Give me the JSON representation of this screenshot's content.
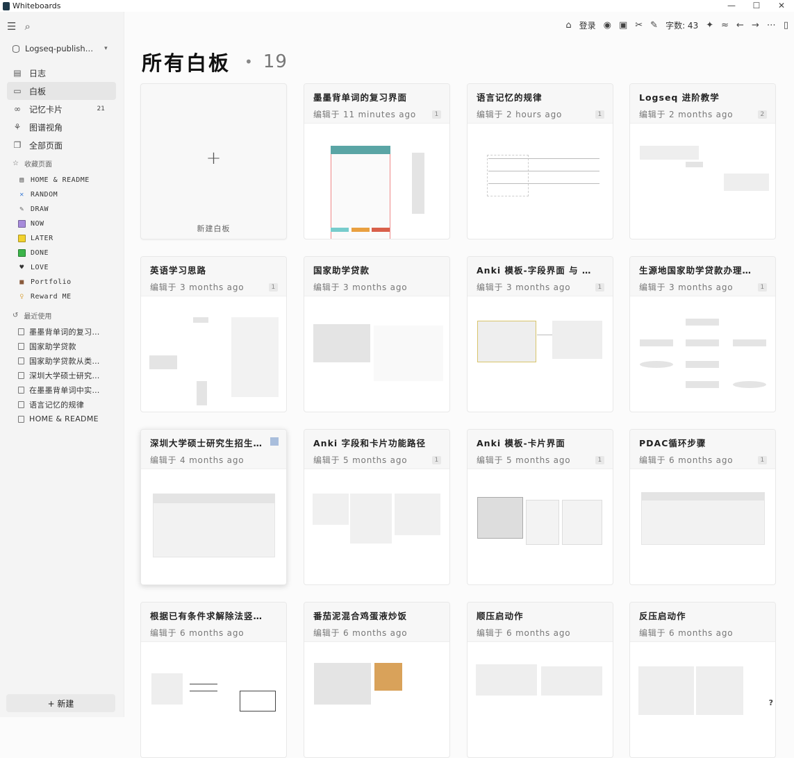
{
  "window": {
    "title": "Whiteboards",
    "min": "—",
    "max": "☐",
    "close": "✕"
  },
  "sidebar": {
    "graph": "Logseq-publish…",
    "nav": [
      {
        "icon": "▤",
        "label": "日志",
        "count": ""
      },
      {
        "icon": "▭",
        "label": "白板",
        "count": ""
      },
      {
        "icon": "∞",
        "label": "记忆卡片",
        "count": "21"
      },
      {
        "icon": "⚘",
        "label": "图谱视角",
        "count": ""
      },
      {
        "icon": "❐",
        "label": "全部页面",
        "count": ""
      }
    ],
    "favorites_header": "收藏页面",
    "favorites": [
      {
        "label": "HOME & README",
        "icon": "▤",
        "color": "#555"
      },
      {
        "label": "RANDOM",
        "icon": "✕",
        "color": "#3a7bd5"
      },
      {
        "label": "DRAW",
        "icon": "✎",
        "color": "#666"
      },
      {
        "label": "NOW",
        "icon": "",
        "color": "#a78bdb"
      },
      {
        "label": "LATER",
        "icon": "",
        "color": "#f2d22e"
      },
      {
        "label": "DONE",
        "icon": "",
        "color": "#3cb54a"
      },
      {
        "label": "LOVE",
        "icon": "♥",
        "color": "#333"
      },
      {
        "label": "Portfolio",
        "icon": "■",
        "color": "#8a5a3c"
      },
      {
        "label": "Reward ME",
        "icon": "♀",
        "color": "#d9a441"
      }
    ],
    "recent_header": "最近使用",
    "recent": [
      "墨墨背单词的复习…",
      "国家助学贷款",
      "国家助学贷款从类…",
      "深圳大学硕士研究…",
      "在墨墨背单词中实…",
      "语言记忆的规律",
      "HOME & README"
    ],
    "new_button": "+ 新建"
  },
  "toolbar": {
    "login": "登录",
    "word_count": "字数: 43"
  },
  "page": {
    "title": "所有白板",
    "count": "19"
  },
  "new_card_label": "新建白板",
  "cards": [
    {
      "title": "墨墨背单词的复习界面",
      "meta": "编辑于 11 minutes ago",
      "badge": "1"
    },
    {
      "title": "语言记忆的规律",
      "meta": "编辑于 2 hours ago",
      "badge": "1"
    },
    {
      "title": "Logseq 进阶教学",
      "meta": "编辑于 2 months ago",
      "badge": "2"
    },
    {
      "title": "英语学习思路",
      "meta": "编辑于 3 months ago",
      "badge": "1"
    },
    {
      "title": "国家助学贷款",
      "meta": "编辑于 3 months ago",
      "badge": ""
    },
    {
      "title": "Anki 模板-字段界面 与 …",
      "meta": "编辑于 3 months ago",
      "badge": "1"
    },
    {
      "title": "生源地国家助学贷款办理…",
      "meta": "编辑于 3 months ago",
      "badge": "1"
    },
    {
      "title": "深圳大学硕士研究生招生…",
      "meta": "编辑于 4 months ago",
      "badge": ""
    },
    {
      "title": "Anki 字段和卡片功能路径",
      "meta": "编辑于 5 months ago",
      "badge": "1"
    },
    {
      "title": "Anki 模板-卡片界面",
      "meta": "编辑于 5 months ago",
      "badge": "1"
    },
    {
      "title": "PDAC循环步骤",
      "meta": "编辑于 6 months ago",
      "badge": "1"
    },
    {
      "title": "根据已有条件求解除法竖…",
      "meta": "编辑于 6 months ago",
      "badge": ""
    },
    {
      "title": "番茄泥混合鸡蛋液炒饭",
      "meta": "编辑于 6 months ago",
      "badge": ""
    },
    {
      "title": "顺压启动作",
      "meta": "编辑于 6 months ago",
      "badge": ""
    },
    {
      "title": "反压启动作",
      "meta": "编辑于 6 months ago",
      "badge": ""
    }
  ],
  "help": "?"
}
